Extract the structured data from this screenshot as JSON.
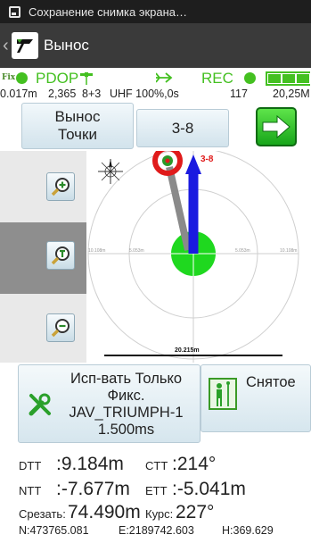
{
  "status_bar": {
    "notification_text": "Сохранение снимка экрана…"
  },
  "action_bar": {
    "title": "Вынос"
  },
  "gnss_status": {
    "fix_label": "Fix",
    "pdop_label": "PDOP",
    "rec_label": "REC",
    "precision": "0.017m",
    "pdop_value": "2,365",
    "satellites": "8+3",
    "link": "UHF 100%,0s",
    "epochs": "117",
    "elapsed": "20,25M",
    "status_color": "#44c021"
  },
  "toolbar": {
    "stakeout_points_label_line1": "Вынос",
    "stakeout_points_label_line2": "Точки",
    "point_selector_value": "3-8"
  },
  "map": {
    "target_point_label": "3-8",
    "scale_bar_label": "20.215m",
    "ring_label_left_outer": "10.108m",
    "ring_label_left_inner": "5.053m",
    "ring_label_right_inner": "5.053m",
    "ring_label_right_outer": "10.108m",
    "icons": [
      "zoom-in-icon",
      "zoom-fit-icon",
      "zoom-out-icon",
      "compass-rose-icon"
    ]
  },
  "bottom_panel": {
    "fixed_only_line1": "Исп-вать Только",
    "fixed_only_line2": "Фикс.",
    "fixed_only_line3": "JAV_TRIUMPH-1",
    "fixed_only_line4": "1.500ms",
    "measured_label": "Снятое"
  },
  "readouts": {
    "dtt_label": "DTT",
    "dtt_value": ":9.184m",
    "ctt_label": "CTT",
    "ctt_value": ":214°",
    "ntt_label": "NTT",
    "ntt_value": ":-7.677m",
    "ett_label": "ETT",
    "ett_value": ":-5.041m",
    "cut_label": "Срезать:",
    "cut_value": "74.490m",
    "course_label": "Курс:",
    "course_value": "227°",
    "northing": "N:473765.081",
    "easting": "E:2189742.603",
    "height": "H:369.629"
  }
}
